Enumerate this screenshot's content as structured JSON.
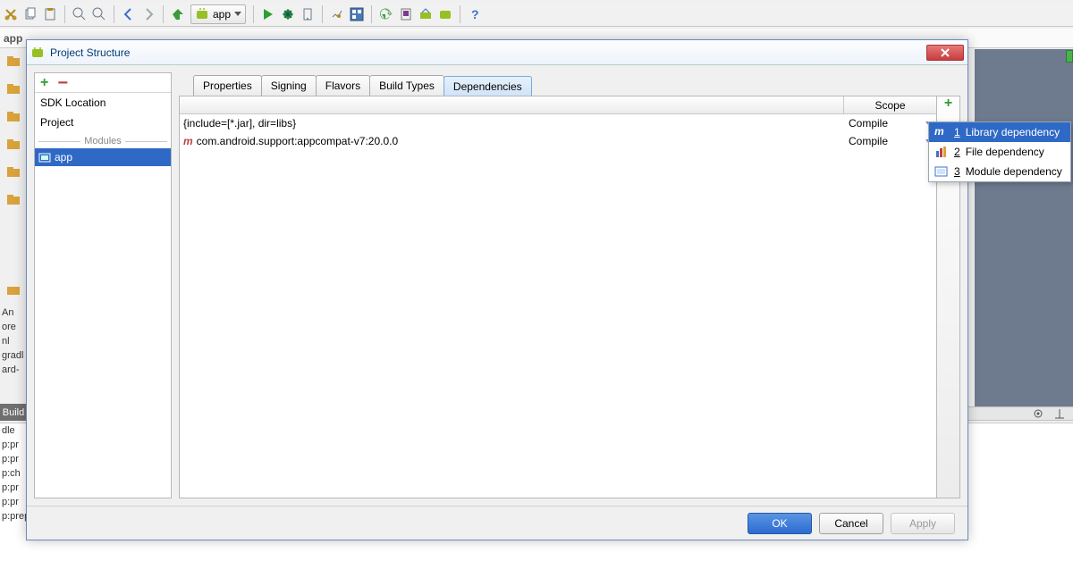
{
  "ide": {
    "module_combo": "app",
    "breadcrumb": "app",
    "build_tab": "Build",
    "console_lines": [
      "dle",
      "p:pr",
      "p:pr",
      "p:ch",
      "p:pr",
      "p:pr",
      "p:prepareDebugDependencies"
    ],
    "proj_files": [
      "An",
      "ore",
      "nl",
      "gradl",
      "ard-"
    ]
  },
  "dialog": {
    "title": "Project Structure",
    "left": {
      "sdk": "SDK Location",
      "project": "Project",
      "mods_label": "Modules",
      "selected_module": "app"
    },
    "tabs": {
      "properties": "Properties",
      "signing": "Signing",
      "flavors": "Flavors",
      "buildtypes": "Build Types",
      "dependencies": "Dependencies"
    },
    "scope_header": "Scope",
    "rows": [
      {
        "name": "{include=[*.jar], dir=libs}",
        "scope": "Compile",
        "icon": "none"
      },
      {
        "name": "com.android.support:appcompat-v7:20.0.0",
        "scope": "Compile",
        "icon": "m"
      }
    ],
    "buttons": {
      "ok": "OK",
      "cancel": "Cancel",
      "apply": "Apply"
    }
  },
  "popup": {
    "items": [
      {
        "n": "1",
        "label": "Library dependency"
      },
      {
        "n": "2",
        "label": "File dependency"
      },
      {
        "n": "3",
        "label": "Module dependency"
      }
    ]
  }
}
